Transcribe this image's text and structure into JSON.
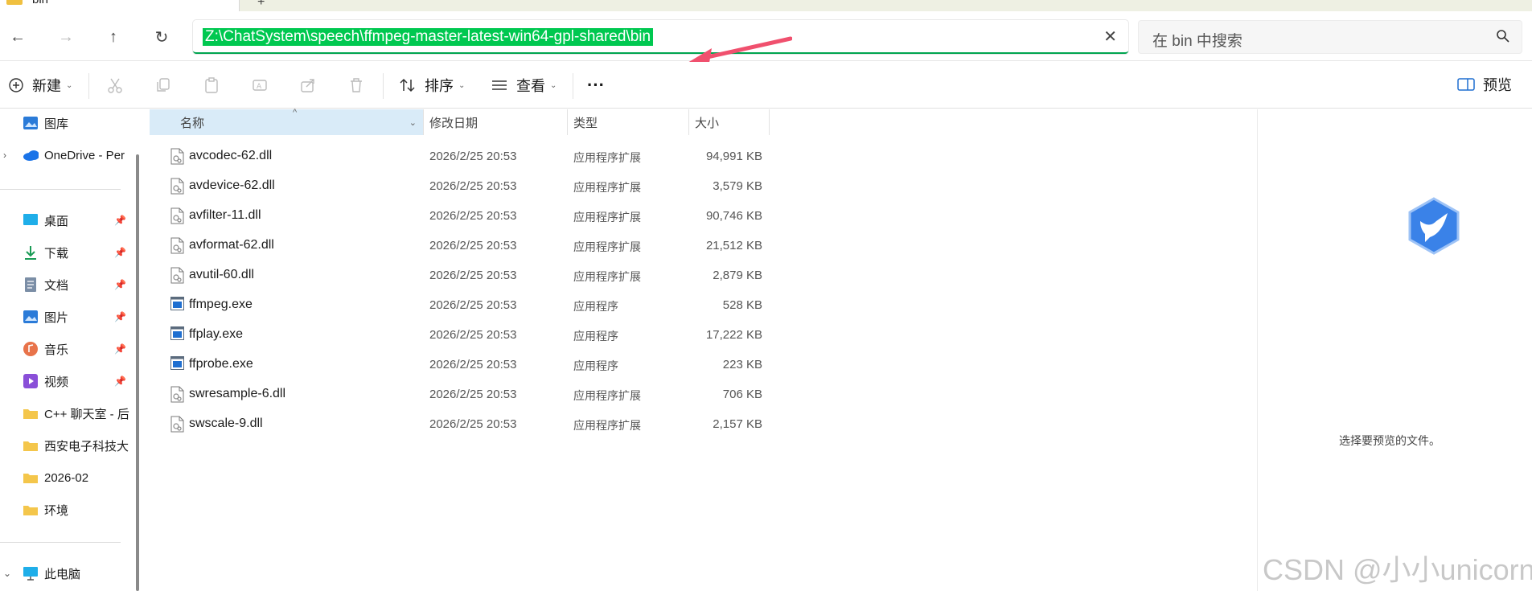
{
  "tab": {
    "title": "bin",
    "new_tab": "+"
  },
  "nav": {
    "back": "←",
    "forward": "→",
    "up": "↑",
    "refresh": "↻"
  },
  "address": {
    "path": "Z:\\ChatSystem\\speech\\ffmpeg-master-latest-win64-gpl-shared\\bin",
    "clear": "✕"
  },
  "search": {
    "placeholder": "在 bin 中搜索"
  },
  "commands": {
    "new": "新建",
    "sort": "排序",
    "view": "查看",
    "more": "···",
    "preview": "预览"
  },
  "sidebar": {
    "top_items": [
      {
        "label": "图库",
        "icon": "gallery-icon"
      },
      {
        "label": "OneDrive - Per",
        "icon": "onedrive-icon"
      }
    ],
    "quick_access": [
      {
        "label": "桌面",
        "icon": "desktop-icon",
        "pinned": true
      },
      {
        "label": "下载",
        "icon": "download-icon",
        "pinned": true
      },
      {
        "label": "文档",
        "icon": "documents-icon",
        "pinned": true
      },
      {
        "label": "图片",
        "icon": "pictures-icon",
        "pinned": true
      },
      {
        "label": "音乐",
        "icon": "music-icon",
        "pinned": true
      },
      {
        "label": "视频",
        "icon": "videos-icon",
        "pinned": true
      },
      {
        "label": "C++ 聊天室 - 后",
        "icon": "folder-icon",
        "pinned": false
      },
      {
        "label": "西安电子科技大",
        "icon": "folder-icon",
        "pinned": false
      },
      {
        "label": "2026-02",
        "icon": "folder-icon",
        "pinned": false
      },
      {
        "label": "环境",
        "icon": "folder-icon",
        "pinned": false
      }
    ],
    "this_pc": {
      "label": "此电脑",
      "icon": "computer-icon"
    }
  },
  "columns": {
    "name": "名称",
    "date": "修改日期",
    "type": "类型",
    "size": "大小"
  },
  "files": [
    {
      "name": "avcodec-62.dll",
      "date": "2026/2/25 20:53",
      "type": "应用程序扩展",
      "size": "94,991 KB",
      "kind": "dll"
    },
    {
      "name": "avdevice-62.dll",
      "date": "2026/2/25 20:53",
      "type": "应用程序扩展",
      "size": "3,579 KB",
      "kind": "dll"
    },
    {
      "name": "avfilter-11.dll",
      "date": "2026/2/25 20:53",
      "type": "应用程序扩展",
      "size": "90,746 KB",
      "kind": "dll"
    },
    {
      "name": "avformat-62.dll",
      "date": "2026/2/25 20:53",
      "type": "应用程序扩展",
      "size": "21,512 KB",
      "kind": "dll"
    },
    {
      "name": "avutil-60.dll",
      "date": "2026/2/25 20:53",
      "type": "应用程序扩展",
      "size": "2,879 KB",
      "kind": "dll"
    },
    {
      "name": "ffmpeg.exe",
      "date": "2026/2/25 20:53",
      "type": "应用程序",
      "size": "528 KB",
      "kind": "exe"
    },
    {
      "name": "ffplay.exe",
      "date": "2026/2/25 20:53",
      "type": "应用程序",
      "size": "17,222 KB",
      "kind": "exe"
    },
    {
      "name": "ffprobe.exe",
      "date": "2026/2/25 20:53",
      "type": "应用程序",
      "size": "223 KB",
      "kind": "exe"
    },
    {
      "name": "swresample-6.dll",
      "date": "2026/2/25 20:53",
      "type": "应用程序扩展",
      "size": "706 KB",
      "kind": "dll"
    },
    {
      "name": "swscale-9.dll",
      "date": "2026/2/25 20:53",
      "type": "应用程序扩展",
      "size": "2,157 KB",
      "kind": "dll"
    }
  ],
  "preview": {
    "message": "选择要预览的文件。"
  },
  "watermark": "CSDN @小小unicorn",
  "colors": {
    "accent_green": "#00c850",
    "selected_header": "#d9ebf8",
    "arrow_red": "#f0506e"
  }
}
